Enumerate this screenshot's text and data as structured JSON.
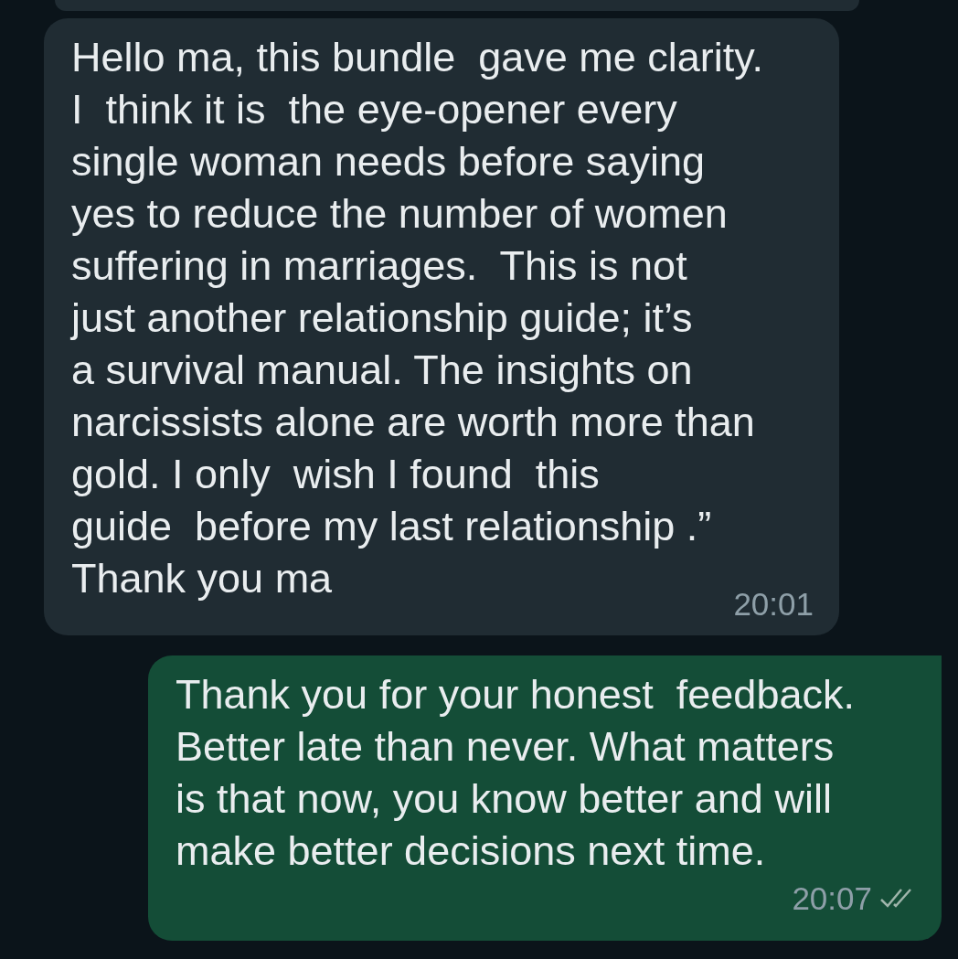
{
  "messages": [
    {
      "outgoing": false,
      "text": "Hello ma, this bundle  gave me clarity.\nI  think it is  the eye-opener every\nsingle woman needs before saying\nyes to reduce the number of women\nsuffering in marriages.  This is not\njust another relationship guide; it’s\na survival manual. The insights on\nnarcissists alone are worth more than\ngold. I only  wish I found  this\nguide  before my last relationship .”\nThank you ma",
      "time": "20:01"
    },
    {
      "outgoing": true,
      "text": "Thank you for your honest  feedback.\nBetter late than never. What matters\nis that now, you know better and will\nmake better decisions next time.",
      "time": "20:07",
      "read": false
    }
  ]
}
